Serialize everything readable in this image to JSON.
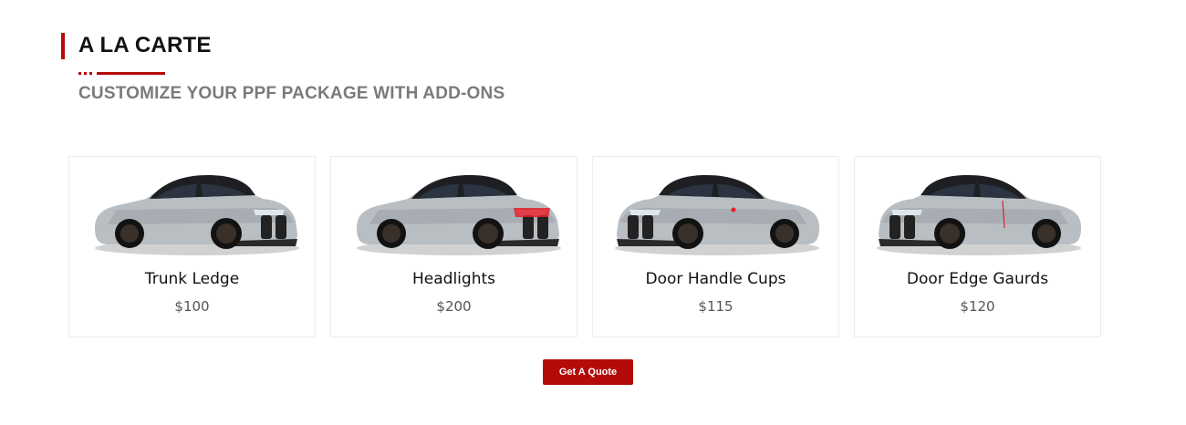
{
  "section": {
    "title": "A LA CARTE",
    "subtitle": "CUSTOMIZE YOUR PPF PACKAGE WITH ADD-ONS"
  },
  "colors": {
    "accent": "#b50a0a",
    "car_body": "#b9bec3",
    "car_roof": "#1e1f22",
    "highlight": "#e0202a"
  },
  "cards": [
    {
      "name": "Trunk Ledge",
      "price": "$100",
      "image_icon": "car-image"
    },
    {
      "name": "Headlights",
      "price": "$200",
      "image_icon": "car-image"
    },
    {
      "name": "Door Handle Cups",
      "price": "$115",
      "image_icon": "car-image"
    },
    {
      "name": "Door Edge Gaurds",
      "price": "$120",
      "image_icon": "car-image"
    }
  ],
  "cta": {
    "label": "Get A Quote"
  }
}
